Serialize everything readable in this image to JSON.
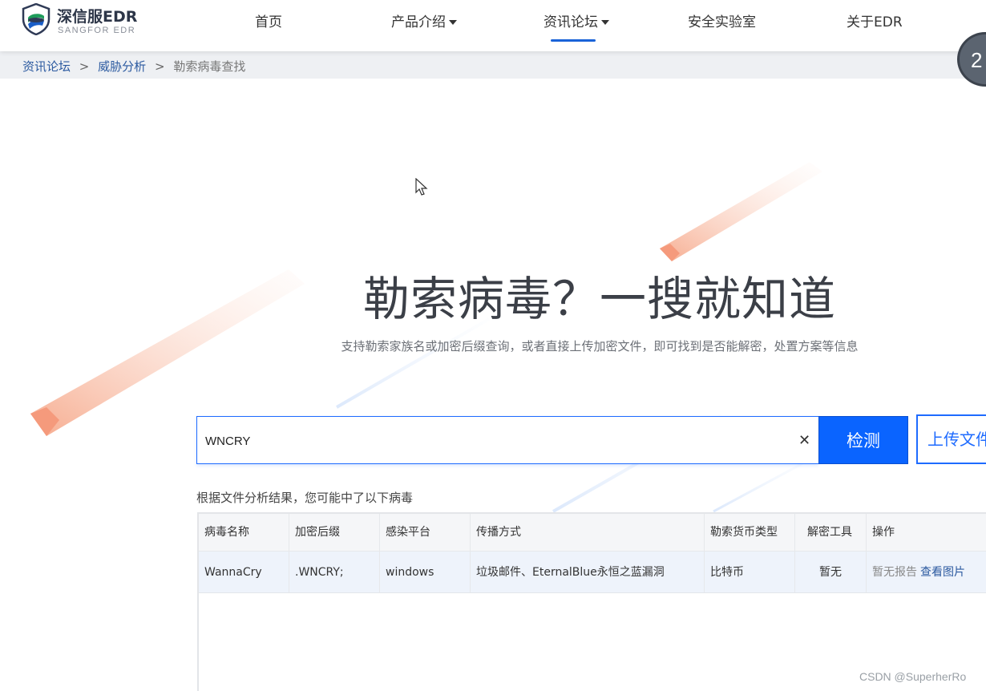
{
  "header": {
    "brand_name": "深信服EDR",
    "brand_sub": "SANGFOR EDR",
    "nav": [
      {
        "label": "首页"
      },
      {
        "label": "产品介绍"
      },
      {
        "label": "资讯论坛"
      },
      {
        "label": "安全实验室"
      },
      {
        "label": "关于EDR"
      }
    ],
    "active_nav": "资讯论坛",
    "float_badge": "2"
  },
  "breadcrumb": {
    "items": [
      "资讯论坛",
      "威胁分析",
      "勒索病毒查找"
    ],
    "separator": ">"
  },
  "hero": {
    "title": "勒索病毒？一搜就知道",
    "subtitle": "支持勒索家族名或加密后缀查询，或者直接上传加密文件，即可找到是否能解密，处置方案等信息"
  },
  "search": {
    "value": "WNCRY",
    "clear_icon": "close-icon",
    "detect_label": "检测",
    "upload_label": "上传文件"
  },
  "results": {
    "label": "根据文件分析结果，您可能中了以下病毒",
    "columns": [
      "病毒名称",
      "加密后缀",
      "感染平台",
      "传播方式",
      "勒索货币类型",
      "解密工具",
      "操作"
    ],
    "rows": [
      {
        "name": "WannaCry",
        "suffix": ".WNCRY;",
        "platform": "windows",
        "spread": "垃圾邮件、EternalBlue永恒之蓝漏洞",
        "currency": "比特币",
        "tool": "暂无",
        "op_report": "暂无报告",
        "op_image": "查看图片"
      }
    ]
  },
  "watermark": "CSDN @SuperherRo",
  "colors": {
    "accent": "#0a64ff",
    "link": "#2c5aa0",
    "deco_orange": "#f7a98a"
  }
}
